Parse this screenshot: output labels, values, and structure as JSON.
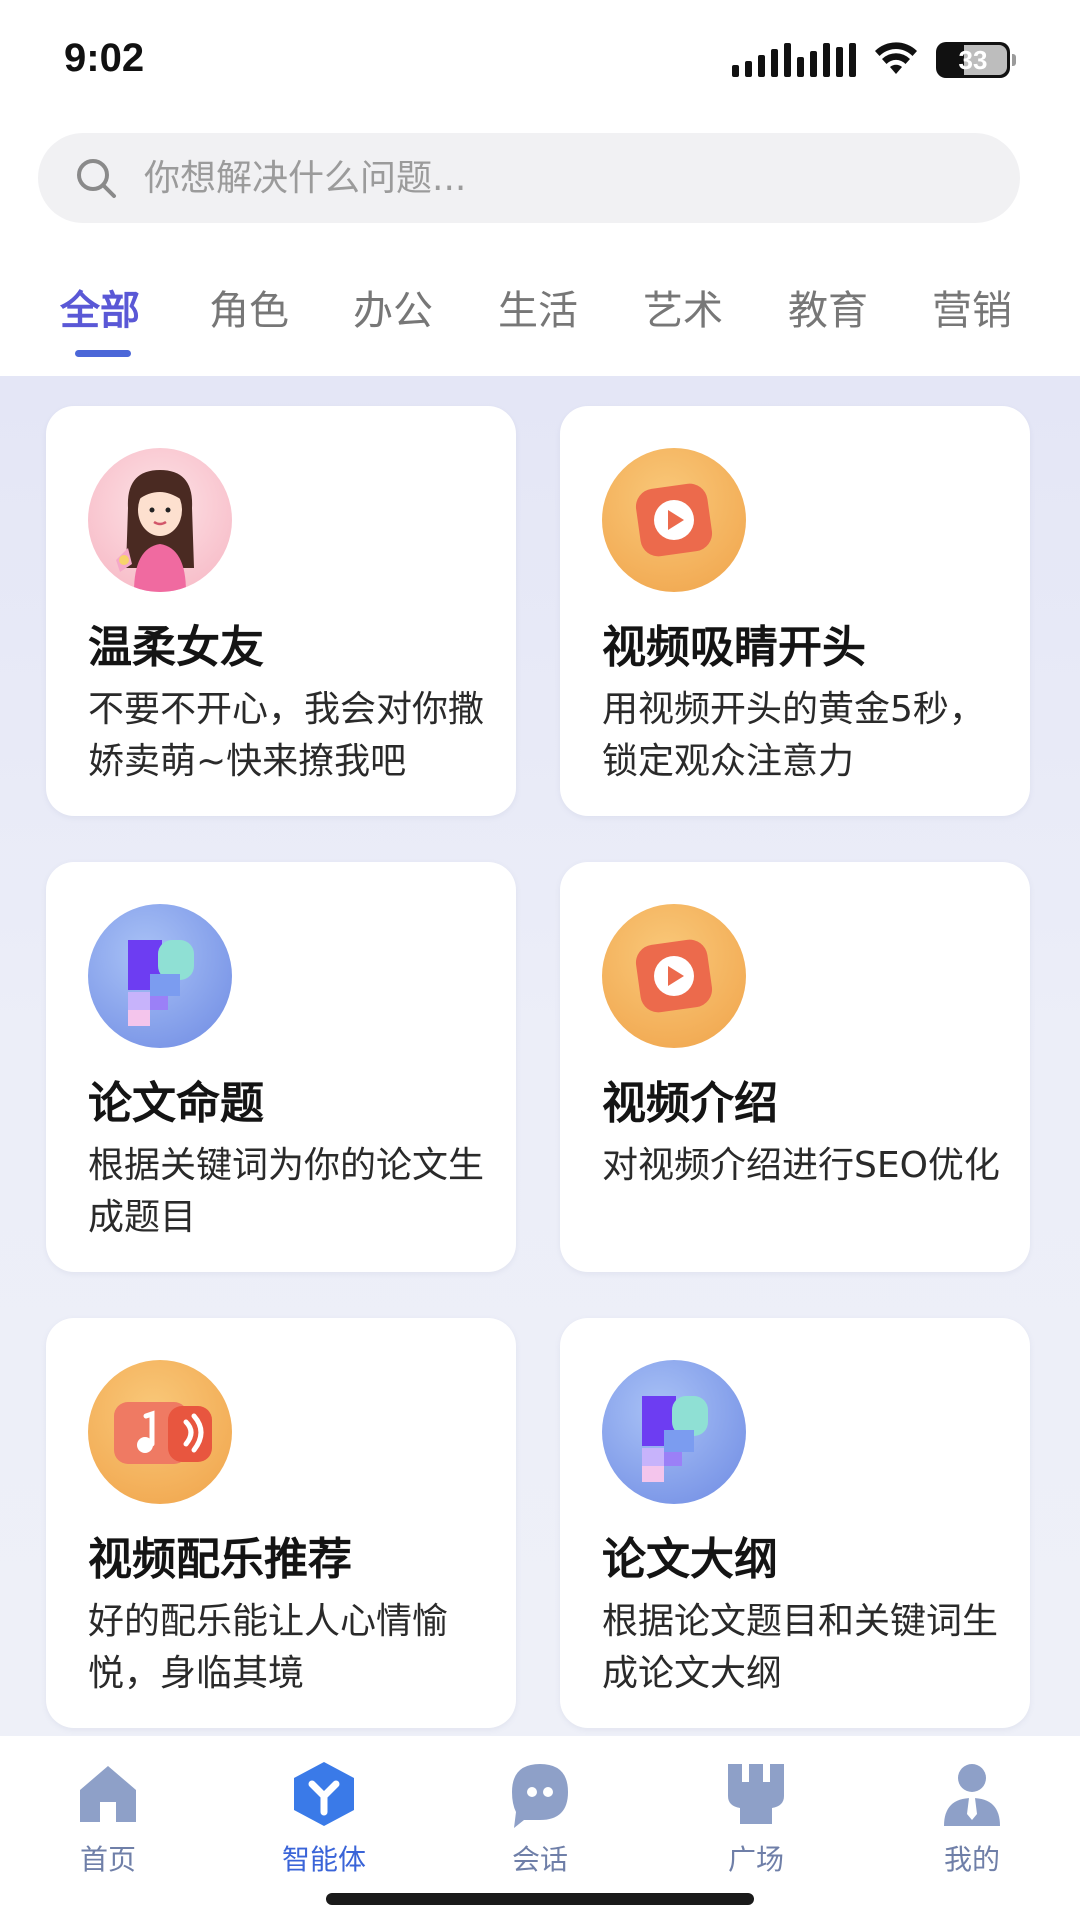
{
  "status_bar": {
    "time": "9:02",
    "battery": "33"
  },
  "search": {
    "placeholder": "你想解决什么问题..."
  },
  "tabs": [
    {
      "label": "全部",
      "active": true
    },
    {
      "label": "角色"
    },
    {
      "label": "办公"
    },
    {
      "label": "生活"
    },
    {
      "label": "艺术"
    },
    {
      "label": "教育"
    },
    {
      "label": "营销"
    }
  ],
  "cards": [
    {
      "title": "温柔女友",
      "desc": "不要不开心，我会对你撒娇卖萌~快来撩我吧",
      "icon": "girlfriend-avatar-icon"
    },
    {
      "title": "视频吸睛开头",
      "desc": "用视频开头的黄金5秒，锁定观众注意力",
      "icon": "video-play-icon"
    },
    {
      "title": "论文命题",
      "desc": "根据关键词为你的论文生成题目",
      "icon": "paper-blocks-icon"
    },
    {
      "title": "视频介绍",
      "desc": "对视频介绍进行SEO优化",
      "icon": "video-play-icon"
    },
    {
      "title": "视频配乐推荐",
      "desc": "好的配乐能让人心情愉悦，身临其境",
      "icon": "music-note-icon"
    },
    {
      "title": "论文大纲",
      "desc": "根据论文题目和关键词生成论文大纲",
      "icon": "paper-blocks-icon"
    }
  ],
  "bottom_nav": [
    {
      "label": "首页",
      "icon": "home-icon"
    },
    {
      "label": "智能体",
      "icon": "agent-cube-icon",
      "active": true
    },
    {
      "label": "会话",
      "icon": "chat-bubble-icon"
    },
    {
      "label": "广场",
      "icon": "plaza-icon"
    },
    {
      "label": "我的",
      "icon": "profile-icon"
    }
  ],
  "colors": {
    "accent": "#4b67d8",
    "active_tab": "#5a58d6",
    "nav_inactive": "#6f7fa8",
    "background_gradient": "#e4e6f6"
  }
}
